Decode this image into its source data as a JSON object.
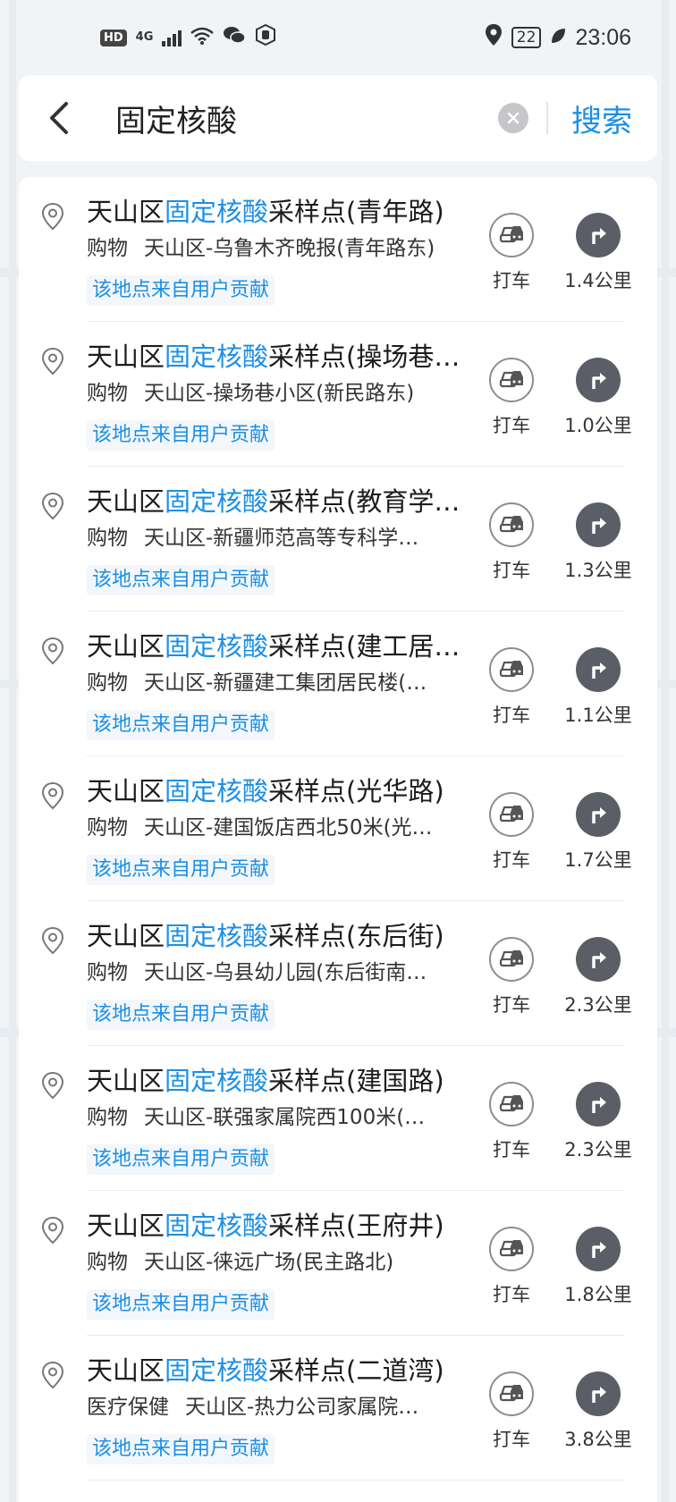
{
  "status": {
    "hd": "HD",
    "net_top": "4G",
    "net_bottom": "ıl",
    "battery": "22",
    "time": "23:06"
  },
  "search": {
    "query": "固定核酸",
    "button": "搜索"
  },
  "results": [
    {
      "prefix": "天山区",
      "highlight": "固定核酸",
      "suffix": "采样点(青年路)",
      "category": "购物",
      "address": "天山区-乌鲁木齐晚报(青年路东)",
      "tag": "该地点来自用户贡献",
      "taxi": "打车",
      "distance": "1.4公里"
    },
    {
      "prefix": "天山区",
      "highlight": "固定核酸",
      "suffix": "采样点(操场巷…",
      "category": "购物",
      "address": "天山区-操场巷小区(新民路东)",
      "tag": "该地点来自用户贡献",
      "taxi": "打车",
      "distance": "1.0公里"
    },
    {
      "prefix": "天山区",
      "highlight": "固定核酸",
      "suffix": "采样点(教育学…",
      "category": "购物",
      "address": "天山区-新疆师范高等专科学…",
      "tag": "该地点来自用户贡献",
      "taxi": "打车",
      "distance": "1.3公里"
    },
    {
      "prefix": "天山区",
      "highlight": "固定核酸",
      "suffix": "采样点(建工居…",
      "category": "购物",
      "address": "天山区-新疆建工集团居民楼(…",
      "tag": "该地点来自用户贡献",
      "taxi": "打车",
      "distance": "1.1公里"
    },
    {
      "prefix": "天山区",
      "highlight": "固定核酸",
      "suffix": "采样点(光华路)",
      "category": "购物",
      "address": "天山区-建国饭店西北50米(光…",
      "tag": "该地点来自用户贡献",
      "taxi": "打车",
      "distance": "1.7公里"
    },
    {
      "prefix": "天山区",
      "highlight": "固定核酸",
      "suffix": "采样点(东后街)",
      "category": "购物",
      "address": "天山区-乌县幼儿园(东后街南…",
      "tag": "该地点来自用户贡献",
      "taxi": "打车",
      "distance": "2.3公里"
    },
    {
      "prefix": "天山区",
      "highlight": "固定核酸",
      "suffix": "采样点(建国路)",
      "category": "购物",
      "address": "天山区-联强家属院西100米(…",
      "tag": "该地点来自用户贡献",
      "taxi": "打车",
      "distance": "2.3公里"
    },
    {
      "prefix": "天山区",
      "highlight": "固定核酸",
      "suffix": "采样点(王府井)",
      "category": "购物",
      "address": "天山区-徕远广场(民主路北)",
      "tag": "该地点来自用户贡献",
      "taxi": "打车",
      "distance": "1.8公里"
    },
    {
      "prefix": "天山区",
      "highlight": "固定核酸",
      "suffix": "采样点(二道湾)",
      "category": "医疗保健",
      "address": "天山区-热力公司家属院…",
      "tag": "该地点来自用户贡献",
      "taxi": "打车",
      "distance": "3.8公里"
    }
  ],
  "colors": {
    "accent": "#1b8fe6",
    "nav_icon": "#5b5e66"
  }
}
